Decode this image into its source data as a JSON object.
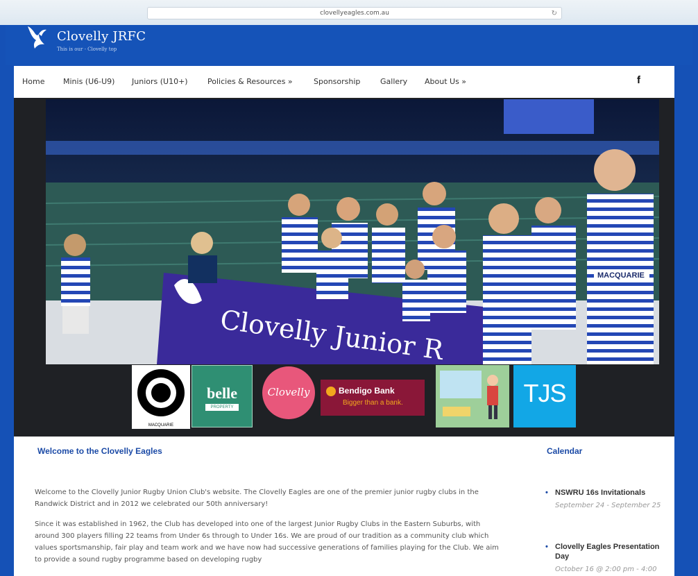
{
  "browser": {
    "url": "clovellyeagles.com.au"
  },
  "site": {
    "title": "Clovelly JRFC",
    "tagline": "This is our - Clovelly top"
  },
  "nav": {
    "items": [
      "Home",
      "Minis (U6-U9)",
      "Juniors (U10+)",
      "Policies & Resources »",
      "Sponsorship",
      "Gallery",
      "About Us »"
    ],
    "social_icon": "f"
  },
  "hero": {
    "banner_text": "Clovelly Junior R",
    "jersey_sponsor": "MACQUARIE"
  },
  "sponsors": {
    "macquarie": "MACQUARIE",
    "belle_title": "belle",
    "belle_sub": "PROPERTY",
    "clovelly": "Clovelly",
    "bendigo_title": "Bendigo Bank",
    "bendigo_sub": "Bigger than a bank.",
    "tjs": "TJS"
  },
  "welcome": {
    "heading": "Welcome to the Clovelly Eagles",
    "paragraphs": [
      "Welcome to the Clovelly Junior Rugby Union Club's website.  The Clovelly Eagles are one of the premier junior rugby clubs in the Randwick District and in 2012 we celebrated our 50th anniversary!",
      "Since it was established in 1962, the Club has developed into one of the largest Junior Rugby Clubs in the Eastern Suburbs, with around 300 players filling 22 teams from Under 6s through to Under 16s.  We are proud of our tradition as a community club which values sportsmanship, fair play and team work and we have now had successive generations of families playing for the Club. We aim to provide a sound rugby programme based on developing rugby"
    ]
  },
  "calendar": {
    "heading": "Calendar",
    "events": [
      {
        "title": "NSWRU 16s Invitationals",
        "date": "September 24 - September 25"
      },
      {
        "title": "Clovelly Eagles Presentation Day",
        "date": "October 16 @ 2:00 pm - 4:00"
      }
    ]
  },
  "colors": {
    "brand_blue": "#1553b8",
    "heading_blue": "#1b4aa6",
    "jersey_blue": "#2447b5"
  }
}
